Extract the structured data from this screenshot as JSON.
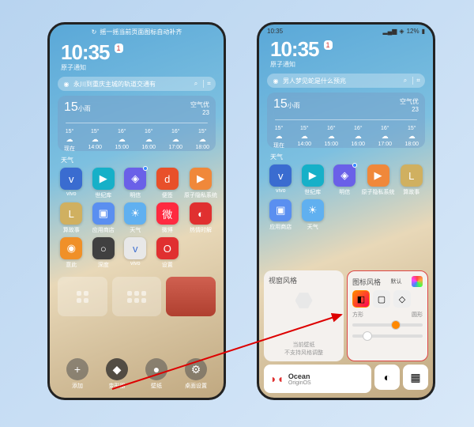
{
  "status": {
    "time": "10:35",
    "battery": "12%"
  },
  "tip": "摇一摇当前页面图标自动补齐",
  "clock": {
    "time": "10:35",
    "date": "1",
    "sub": "原子通知"
  },
  "search_left": "永川到重庆主城的轨道交通有",
  "search_right": "男人梦见蛇是什么预兆",
  "weather": {
    "temp": "15",
    "cond": "小雨",
    "aqi_label": "空气优",
    "aqi": "23",
    "hours": [
      {
        "t": "现在",
        "v": "15°"
      },
      {
        "t": "14:00",
        "v": "15°"
      },
      {
        "t": "15:00",
        "v": "16°"
      },
      {
        "t": "16:00",
        "v": "16°"
      },
      {
        "t": "17:00",
        "v": "16°"
      },
      {
        "t": "18:00",
        "v": "15°"
      }
    ],
    "label": "天气"
  },
  "apps_left": [
    {
      "n": "vivo",
      "c": "#3a6cd0",
      "g": "v"
    },
    {
      "n": "世纪库",
      "c": "#16b0c8",
      "g": "▶"
    },
    {
      "n": "明信",
      "c": "#6a60e8",
      "g": "◈"
    },
    {
      "n": "便签",
      "c": "#e8502a",
      "g": "d"
    },
    {
      "n": "原子隐私系统",
      "c": "#f0883a",
      "g": "▶"
    },
    {
      "n": "算故事",
      "c": "#d0b060",
      "g": "L"
    },
    {
      "n": "应用商店",
      "c": "#5a8ff0",
      "g": "▣"
    },
    {
      "n": "天气",
      "c": "#60b0f0",
      "g": "☀"
    },
    {
      "n": "微博",
      "c": "#ff2a40",
      "g": "微"
    },
    {
      "n": "热情时解",
      "c": "#e03030",
      "g": "◐"
    },
    {
      "n": "意此",
      "c": "#f09028",
      "g": "◉"
    },
    {
      "n": "深度",
      "c": "#404040",
      "g": "○"
    },
    {
      "n": "vivo",
      "c": "#e8e8e8",
      "g": "v",
      "tc": "#4070d0"
    },
    {
      "n": "设置",
      "c": "#e03030",
      "g": "O"
    }
  ],
  "apps_right": [
    {
      "n": "vivo",
      "c": "#3a6cd0",
      "g": "v"
    },
    {
      "n": "世纪库",
      "c": "#16b0c8",
      "g": "▶"
    },
    {
      "n": "明信",
      "c": "#6a60e8",
      "g": "◈"
    },
    {
      "n": "原子隐私系统",
      "c": "#f0883a",
      "g": "▶"
    },
    {
      "n": "算故事",
      "c": "#d0b060",
      "g": "L"
    },
    {
      "n": "应用商店",
      "c": "#5a8ff0",
      "g": "▣"
    },
    {
      "n": "天气",
      "c": "#60b0f0",
      "g": "☀"
    }
  ],
  "dock": [
    {
      "k": "add",
      "l": "添加",
      "g": "+"
    },
    {
      "k": "style",
      "l": "变形器",
      "g": "◆",
      "active": true
    },
    {
      "k": "wallpaper",
      "l": "壁纸",
      "g": "●"
    },
    {
      "k": "settings",
      "l": "桌面设置",
      "g": "⚙"
    }
  ],
  "panel": {
    "tab_widget": "视窗风格",
    "tab_icon": "图标风格",
    "tab_icon_sub": "默认",
    "note": "当前壁纸\n不支持风格调整",
    "slider1_l": "方形",
    "slider1_r": "圆形",
    "slider2_l": "",
    "slider2_r": ""
  },
  "origin": {
    "brand": "Ocean",
    "sub": "OriginOS"
  }
}
